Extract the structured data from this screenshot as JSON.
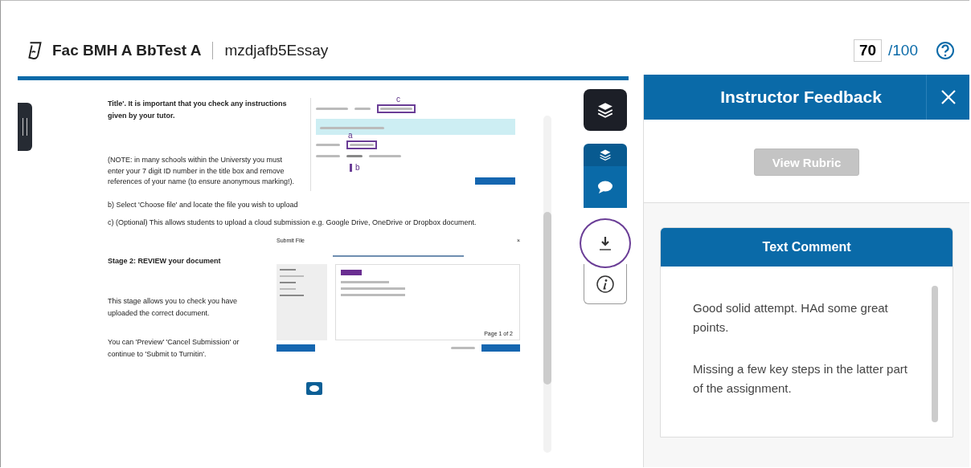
{
  "header": {
    "course": "Fac BMH A BbTest A",
    "assignment": "mzdjafb5Essay",
    "score": "70",
    "max_score": "/100"
  },
  "document": {
    "intro": "Title'. It is important that you check any instructions given by your tutor.",
    "note": "(NOTE: in many schools within the Universty you must enter your 7 digit ID number in the title box and remove references of your name (to ensure anonymous marking!).",
    "upload_screenshot": {
      "marks": [
        "c",
        "a",
        "b"
      ]
    },
    "step_b": "b) Select 'Choose file' and locate the file you wish to upload",
    "step_c": "c) (Optional) This allows students to upload a cloud submission e.g. Google Drive, OneDrive or Dropbox document.",
    "stage_heading": "Stage 2: REVIEW your document",
    "stage_text": "This stage allows you to check you have uploaded the correct document.",
    "stage_text_2": "You can 'Preview' 'Cancel Submission' or continue to 'Submit to Turnitin'.",
    "review_screenshot": {
      "title": "Submit File",
      "close": "×",
      "pager": "Page 1 of 2"
    }
  },
  "toolbar": [
    {
      "kind": "layers",
      "selected": false,
      "highlighted": false
    },
    {
      "kind": "layers",
      "selected": true,
      "highlighted": false
    },
    {
      "kind": "comment",
      "selected": true,
      "highlighted": false
    },
    {
      "kind": "download",
      "selected": false,
      "highlighted": true
    },
    {
      "kind": "info",
      "selected": false,
      "highlighted": false
    }
  ],
  "feedback": {
    "title": "Instructor Feedback",
    "rubric_button": {
      "label": "View Rubric",
      "disabled": true
    },
    "comment": {
      "title": "Text Comment",
      "paragraphs": [
        "Good solid attempt.  HAd some great points.",
        "Missing a few key steps in the latter part of the assignment."
      ]
    }
  }
}
